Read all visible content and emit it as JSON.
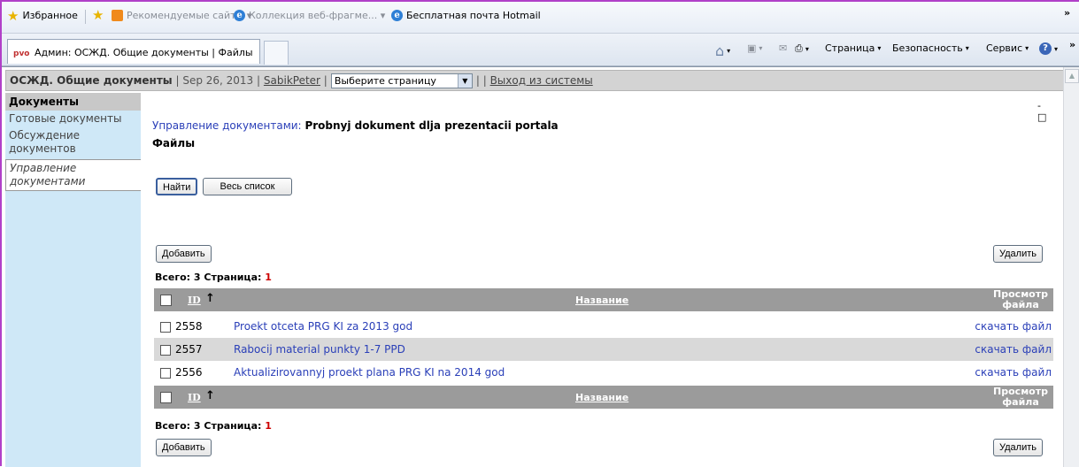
{
  "favorites_bar": {
    "favorites_label": "Избранное",
    "suggested_sites": "Рекомендуемые сайты ▾",
    "web_slices": "Коллекция веб-фрагме... ▾",
    "hotmail": "Бесплатная почта Hotmail"
  },
  "tabs": {
    "active_tab_title": "Админ: ОСЖД. Общие документы | Файлы",
    "active_tab_icon": "pvo"
  },
  "command_bar": {
    "page_menu": "Страница",
    "security_menu": "Безопасность",
    "tools_menu": "Сервис"
  },
  "header": {
    "site_name": "ОСЖД. Общие документы",
    "date": "| Sep 26, 2013 |",
    "user": "SabikPeter",
    "page_select": "Выберите страницу",
    "sep": "| |",
    "logout": "Выход из системы"
  },
  "sidebar": {
    "section_title": "Документы",
    "items": [
      {
        "label": "Готовые документы"
      },
      {
        "label": "Обсуждение документов"
      },
      {
        "label": "Управление документами"
      }
    ]
  },
  "main": {
    "window_controls": "- □",
    "crumb_link": "Управление документами:",
    "document_title": "Probnyj dokument dlja prezentacii portala",
    "section_title": "Файлы",
    "find_button": "Найти",
    "full_list_button": "Весь список",
    "add_button": "Добавить",
    "delete_button": "Удалить",
    "totals_label": "Всего: 3  Страница:",
    "page_number": "1",
    "columns": {
      "id": "ID",
      "name": "Название",
      "view_line1": "Просмотр",
      "view_line2": "файла"
    },
    "rows": [
      {
        "id": "2558",
        "name": "Proekt otceta PRG KI za 2013 god",
        "action": "скачать файл"
      },
      {
        "id": "2557",
        "name": "Rabocij material punkty 1-7 PPD",
        "action": "скачать файл"
      },
      {
        "id": "2556",
        "name": "Aktualizirovannyj proekt plana PRG KI na 2014 god",
        "action": "скачать файл"
      }
    ]
  }
}
